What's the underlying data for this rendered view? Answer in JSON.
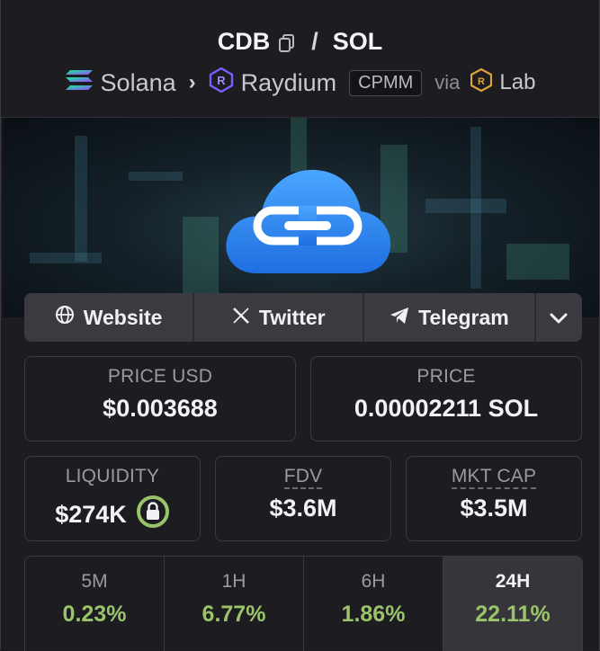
{
  "header": {
    "base_token": "CDB",
    "separator": "/",
    "quote_token": "SOL",
    "chain": "Solana",
    "dex": "Raydium",
    "pool_type": "CPMM",
    "via_label": "via",
    "via_source": "Lab"
  },
  "socials": [
    {
      "label": "Website",
      "icon": "globe-icon"
    },
    {
      "label": "Twitter",
      "icon": "x-icon"
    },
    {
      "label": "Telegram",
      "icon": "telegram-icon"
    }
  ],
  "stats": {
    "price_usd": {
      "label": "PRICE USD",
      "value": "$0.003688"
    },
    "price": {
      "label": "PRICE",
      "value": "0.00002211 SOL"
    },
    "liquidity": {
      "label": "LIQUIDITY",
      "value": "$274K"
    },
    "fdv": {
      "label": "FDV",
      "value": "$3.6M"
    },
    "mkt_cap": {
      "label": "MKT CAP",
      "value": "$3.5M"
    }
  },
  "timeframes": [
    {
      "label": "5M",
      "change": "0.23%"
    },
    {
      "label": "1H",
      "change": "6.77%"
    },
    {
      "label": "6H",
      "change": "1.86%"
    },
    {
      "label": "24H",
      "change": "22.11%"
    }
  ],
  "colors": {
    "positive": "#9ac36a",
    "lock_ring": "#9ac36a",
    "raydium": "#7b5cff",
    "cloud": "#2f8ef0"
  }
}
